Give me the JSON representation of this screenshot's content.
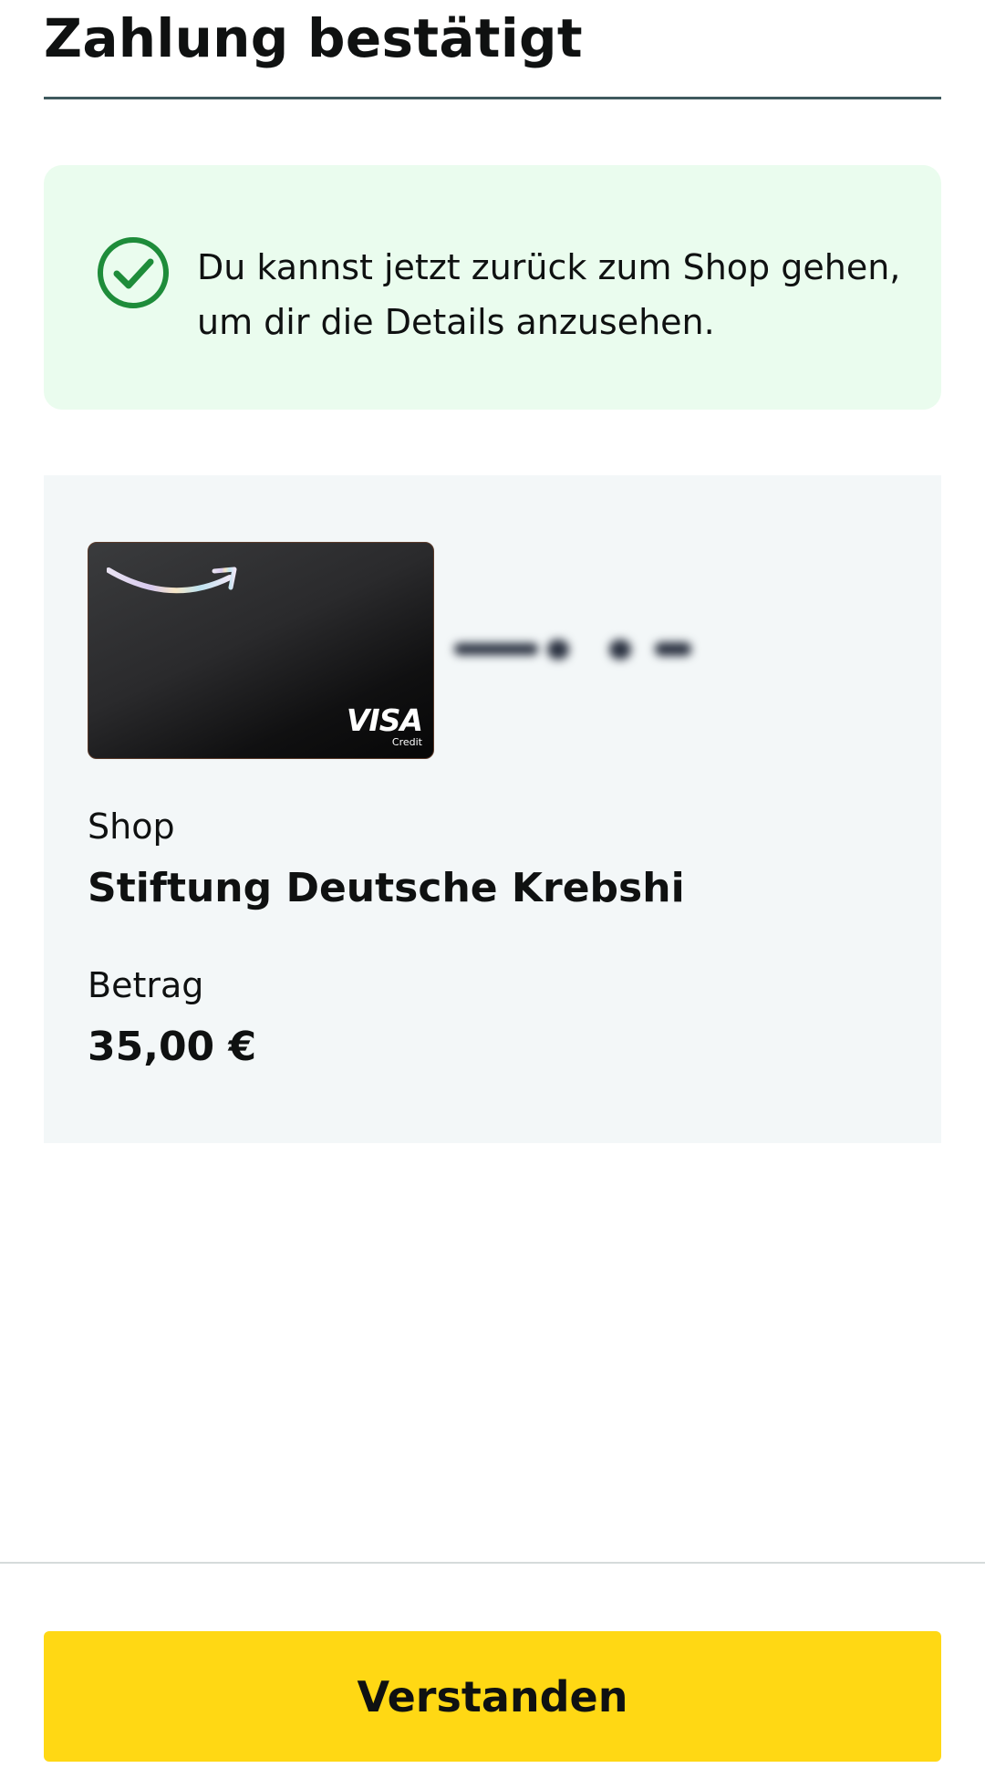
{
  "header": {
    "title": "Zahlung bestätigt"
  },
  "success_alert": {
    "icon": "check-circle-icon",
    "icon_color": "#1e8c3a",
    "background_color": "#eafcee",
    "message_line_1": "Du kannst jetzt zurück zum Shop gehen,",
    "message_line_2": "um dir die Details anzusehen."
  },
  "payment_card": {
    "logo": "amazon-smile-logo",
    "network": "VISA",
    "card_type": "Credit",
    "card_number_masked": "blurred"
  },
  "details": {
    "shop_label": "Shop",
    "shop_value": "Stiftung Deutsche Krebshi",
    "amount_label": "Betrag",
    "amount_value": "35,00 €"
  },
  "footer": {
    "confirm_label": "Verstanden",
    "confirm_color": "#ffd814"
  }
}
